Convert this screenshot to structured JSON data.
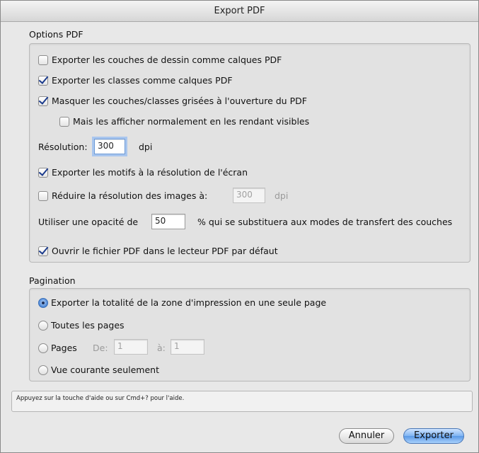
{
  "window": {
    "title": "Export PDF"
  },
  "options": {
    "section_label": "Options PDF",
    "export_layers": {
      "label": "Exporter les couches de dessin comme calques PDF",
      "checked": false
    },
    "export_classes": {
      "label": "Exporter les classes comme calques PDF",
      "checked": true
    },
    "hide_greyed": {
      "label": "Masquer les couches/classes grisées à l'ouverture du PDF",
      "checked": true
    },
    "show_normal": {
      "label": "Mais les afficher normalement en les rendant visibles",
      "checked": false
    },
    "resolution_label": "Résolution:",
    "resolution_value": "300",
    "resolution_unit": "dpi",
    "export_patterns": {
      "label": "Exporter les motifs à la résolution de l'écran",
      "checked": true
    },
    "reduce_images": {
      "label": "Réduire la résolution des images à:",
      "checked": false
    },
    "reduce_value": "300",
    "reduce_unit": "dpi",
    "opacity_label": "Utiliser une opacité de",
    "opacity_value": "50",
    "opacity_suffix": "% qui se substituera aux modes de transfert des couches",
    "open_pdf": {
      "label": "Ouvrir le fichier PDF dans le lecteur PDF par défaut",
      "checked": true
    }
  },
  "pagination": {
    "section_label": "Pagination",
    "whole_area": {
      "label": "Exporter la totalité de la zone d'impression en une seule page",
      "selected": true
    },
    "all_pages": {
      "label": "Toutes les pages",
      "selected": false
    },
    "pages": {
      "label": "Pages",
      "selected": false
    },
    "from_label": "De:",
    "from_value": "1",
    "to_label": "à:",
    "to_value": "1",
    "current_view": {
      "label": "Vue courante seulement",
      "selected": false
    }
  },
  "status_text": "Appuyez sur la touche d'aide ou sur Cmd+? pour l'aide.",
  "buttons": {
    "cancel": "Annuler",
    "export": "Exporter"
  }
}
